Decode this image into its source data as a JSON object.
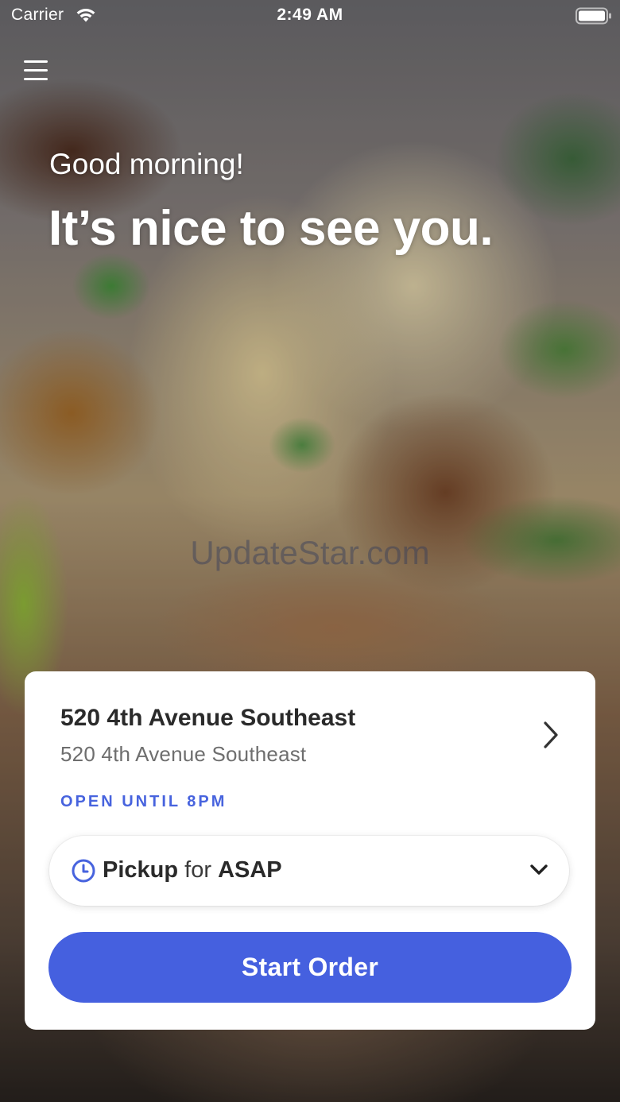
{
  "status_bar": {
    "carrier": "Carrier",
    "time": "2:49 AM"
  },
  "hero": {
    "greeting": "Good morning!",
    "headline": "It’s nice to see you."
  },
  "watermark": "UpdateStar.com",
  "store_card": {
    "name": "520 4th Avenue Southeast",
    "address": "520 4th Avenue Southeast",
    "hours": "OPEN UNTIL 8PM",
    "order_mode": {
      "mode": "Pickup",
      "connector": "for",
      "time": "ASAP"
    },
    "start_button": "Start Order"
  },
  "icons": {
    "menu": "hamburger-menu-icon",
    "wifi": "wifi-icon",
    "battery": "battery-icon",
    "chevron_right": "chevron-right-icon",
    "clock": "clock-icon",
    "chevron_down": "chevron-down-icon"
  },
  "colors": {
    "accent": "#4560df",
    "hours_text": "#4763de",
    "card_bg": "#ffffff"
  }
}
